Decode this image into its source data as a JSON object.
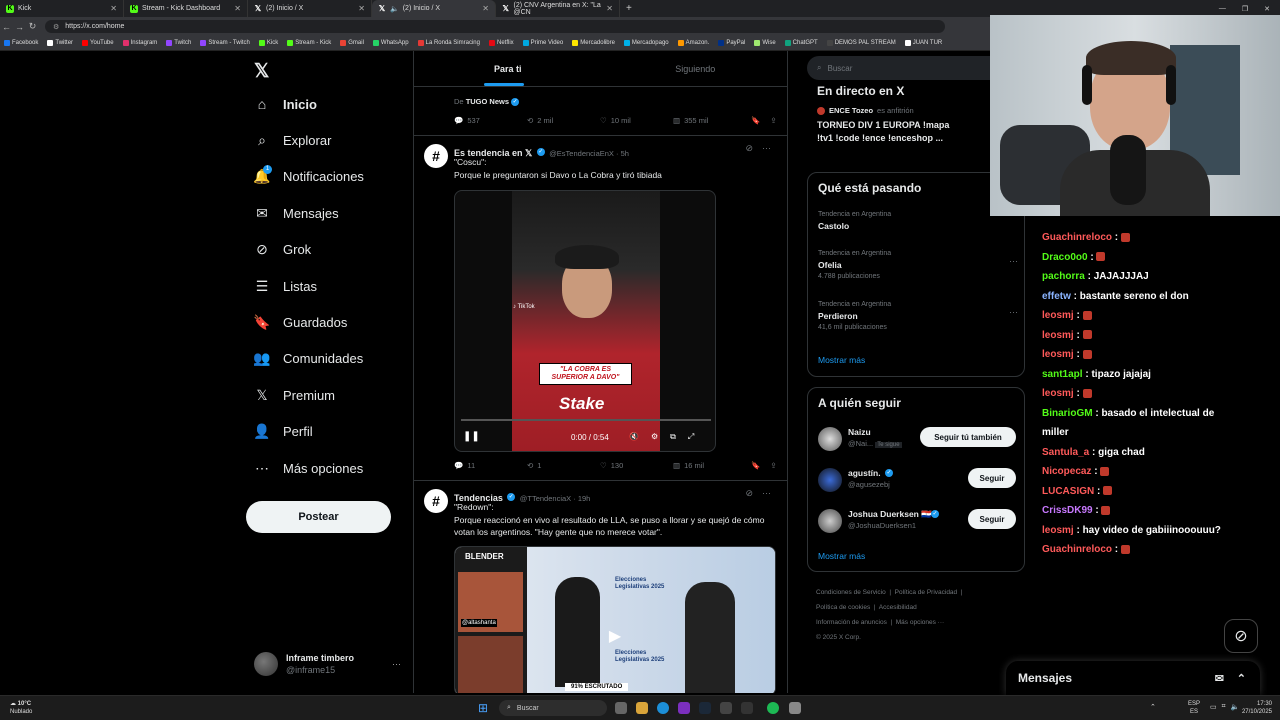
{
  "browser": {
    "tabs": [
      {
        "label": "Kick",
        "icon": "kick-icon",
        "active": false
      },
      {
        "label": "Stream - Kick Dashboard",
        "icon": "kick-icon",
        "active": false
      },
      {
        "label": "(2) Inicio / X",
        "icon": "x-icon",
        "active": false
      },
      {
        "label": "(2) Inicio / X",
        "icon": "x-icon",
        "active": true
      },
      {
        "label": "(2) CNV Argentina en X: \"La @CN",
        "icon": "x-icon",
        "active": false
      }
    ],
    "url": "https://x.com/home",
    "bookmarks": [
      "Facebook",
      "Twitter",
      "YouTube",
      "Instagram",
      "Twitch",
      "Stream - Twitch",
      "Kick",
      "Stream - Kick",
      "Gmail",
      "WhatsApp",
      "La Ronda Simracing",
      "Netflix",
      "Prime Video",
      "Mercadolibre",
      "Mercadopago",
      "Amazon.",
      "PayPal",
      "Wise",
      "ChatGPT",
      "DEMOS PAL STREAM",
      "JUAN TUR"
    ]
  },
  "nav": {
    "items": [
      {
        "label": "Inicio",
        "icon": "home-icon"
      },
      {
        "label": "Explorar",
        "icon": "search-icon"
      },
      {
        "label": "Notificaciones",
        "icon": "bell-icon",
        "badge": "1"
      },
      {
        "label": "Mensajes",
        "icon": "mail-icon"
      },
      {
        "label": "Grok",
        "icon": "grok-icon"
      },
      {
        "label": "Listas",
        "icon": "list-icon"
      },
      {
        "label": "Guardados",
        "icon": "bookmark-icon"
      },
      {
        "label": "Comunidades",
        "icon": "communities-icon"
      },
      {
        "label": "Premium",
        "icon": "x-premium-icon"
      },
      {
        "label": "Perfil",
        "icon": "person-icon"
      },
      {
        "label": "Más opciones",
        "icon": "more-circle-icon"
      }
    ],
    "post_label": "Postear",
    "profile": {
      "name": "Inframe timbero",
      "handle": "@inframe15"
    }
  },
  "feed": {
    "tabs": [
      "Para ti",
      "Siguiendo"
    ],
    "prev_tweet": {
      "source_prefix": "De",
      "source": "TUGO News",
      "replies": "537",
      "reposts": "2 mil",
      "likes": "10 mil",
      "views": "355 mil"
    },
    "tweet1": {
      "name": "Es tendencia en 𝕏",
      "handle": "@EsTendenciaEnX · 5h",
      "line1": "\"Coscu\":",
      "line2": "Porque le preguntaron si Davo o La Cobra y tiró tibiada",
      "video_caption": "\"LA COBRA ES SUPERIOR A DAVO\"",
      "video_brand": "Stake",
      "video_time": "0:00 / 0:54",
      "tiktok": "TikTok",
      "replies": "11",
      "reposts": "1",
      "likes": "130",
      "views": "16 mil"
    },
    "tweet2": {
      "name": "Tendencias",
      "handle": "@TTendenciaX · 19h",
      "line1": "\"Redown\":",
      "line2": "Porque reaccionó en vivo al resultado de LLA, se puso a llorar y se quejó de cómo votan los argentinos. \"Hay gente que no merece votar\".",
      "video_label_top": "Elecciones Legislativas 2025",
      "video_label_bottom": "Elecciones Legislativas 2025",
      "video_ticker": "91% ESCRUTADO",
      "overlay_handle": "@altashanta",
      "blender": "BLENDER"
    }
  },
  "right": {
    "search_placeholder": "Buscar",
    "live": {
      "title": "En directo en X",
      "host": "ENCE Tozeo",
      "host_role": "es anfitrión",
      "line1": "TORNEO DIV 1 EUROPA !mapa",
      "line2": "!tv1 !code !ence !enceshop ..."
    },
    "trends": {
      "title": "Qué está pasando",
      "items": [
        {
          "meta": "Tendencia en Argentina",
          "name": "Castolo",
          "posts": ""
        },
        {
          "meta": "Tendencia en Argentina",
          "name": "Ofelia",
          "posts": "4.788 publicaciones"
        },
        {
          "meta": "Tendencia en Argentina",
          "name": "Perdieron",
          "posts": "41,6 mil publicaciones"
        }
      ],
      "more": "Mostrar más"
    },
    "who": {
      "title": "A quién seguir",
      "items": [
        {
          "name": "Naizu",
          "handle": "@Nai...",
          "follows_you": "Te sigue",
          "button": "Seguir tú también"
        },
        {
          "name": "agustín.",
          "handle": "@agusezebj",
          "follows_you": "",
          "button": "Seguir"
        },
        {
          "name": "Joshua Duerksen 🇵🇾",
          "handle": "@JoshuaDuerksen1",
          "follows_you": "",
          "button": "Seguir"
        }
      ],
      "more": "Mostrar más"
    },
    "footer": [
      "Condiciones de Servicio",
      "Política de Privacidad",
      "Política de cookies",
      "Accesibilidad",
      "Información de anuncios",
      "Más opciones ···",
      "© 2025 X Corp."
    ],
    "messages_label": "Mensajes"
  },
  "chat": [
    {
      "user": "Guachinreloco",
      "color": "#ff5a5a",
      "text": ""
    },
    {
      "user": "Draco0o0",
      "color": "#53fc18",
      "text": ""
    },
    {
      "user": "pachorra",
      "color": "#53fc18",
      "text": "JAJAJJJAJ"
    },
    {
      "user": "effetw",
      "color": "#8ab4ff",
      "text": "bastante sereno el don"
    },
    {
      "user": "leosmj",
      "color": "#ff5a5a",
      "text": ""
    },
    {
      "user": "leosmj",
      "color": "#ff5a5a",
      "text": ""
    },
    {
      "user": "leosmj",
      "color": "#ff5a5a",
      "text": ""
    },
    {
      "user": "sant1apl",
      "color": "#53fc18",
      "text": "tipazo jajajaj"
    },
    {
      "user": "leosmj",
      "color": "#ff5a5a",
      "text": ""
    },
    {
      "user": "BinarioGM",
      "color": "#53fc18",
      "text": "basado el intelectual de"
    },
    {
      "user": "",
      "color": "#fff",
      "text": "miller"
    },
    {
      "user": "Santula_a",
      "color": "#ff5a5a",
      "text": "giga chad"
    },
    {
      "user": "Nicopecaz",
      "color": "#ff5a5a",
      "text": ""
    },
    {
      "user": "LUCASIGN",
      "color": "#ff5a5a",
      "text": ""
    },
    {
      "user": "CrissDK99",
      "color": "#c879ff",
      "text": ""
    },
    {
      "user": "leosmj",
      "color": "#ff5a5a",
      "text": "hay video de gabiiinooouuu?"
    },
    {
      "user": "Guachinreloco",
      "color": "#ff5a5a",
      "text": ""
    }
  ],
  "taskbar": {
    "weather_temp": "10°C",
    "weather_desc": "Nublado",
    "search": "Buscar",
    "lang1": "ESP",
    "lang2": "ES",
    "time": "17:30",
    "date": "27/10/2025"
  }
}
